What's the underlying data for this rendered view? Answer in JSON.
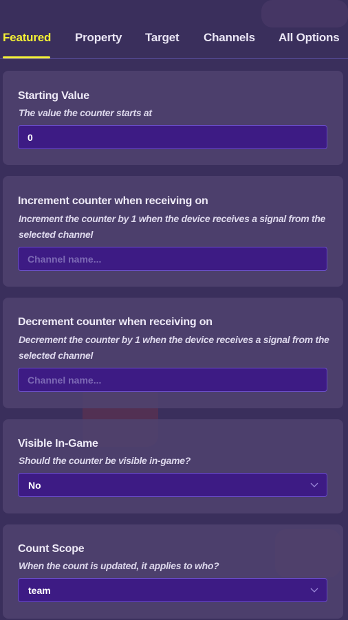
{
  "tabs": [
    {
      "label": "Featured",
      "active": true
    },
    {
      "label": "Property",
      "active": false
    },
    {
      "label": "Target",
      "active": false
    },
    {
      "label": "Channels",
      "active": false
    },
    {
      "label": "All Options",
      "active": false
    }
  ],
  "settings": {
    "starting_value": {
      "title": "Starting Value",
      "description": "The value the counter starts at",
      "value": "0"
    },
    "increment": {
      "title": "Increment counter when receiving on",
      "description": "Increment the counter by 1 when the device receives a signal from the selected channel",
      "placeholder": "Channel name..."
    },
    "decrement": {
      "title": "Decrement counter when receiving on",
      "description": "Decrement the counter by 1 when the device receives a signal from the selected channel",
      "placeholder": "Channel name..."
    },
    "visible": {
      "title": "Visible In-Game",
      "description": "Should the counter be visible in-game?",
      "value": "No"
    },
    "scope": {
      "title": "Count Scope",
      "description": "When the count is updated, it applies to who?",
      "value": "team"
    }
  },
  "colors": {
    "background": "#3a2f5c",
    "active_tab": "#f5f235",
    "input_bg": "#3d1b84",
    "input_border": "#6a4ec7"
  },
  "icons": {
    "dropdown": "chevron-down-icon"
  }
}
